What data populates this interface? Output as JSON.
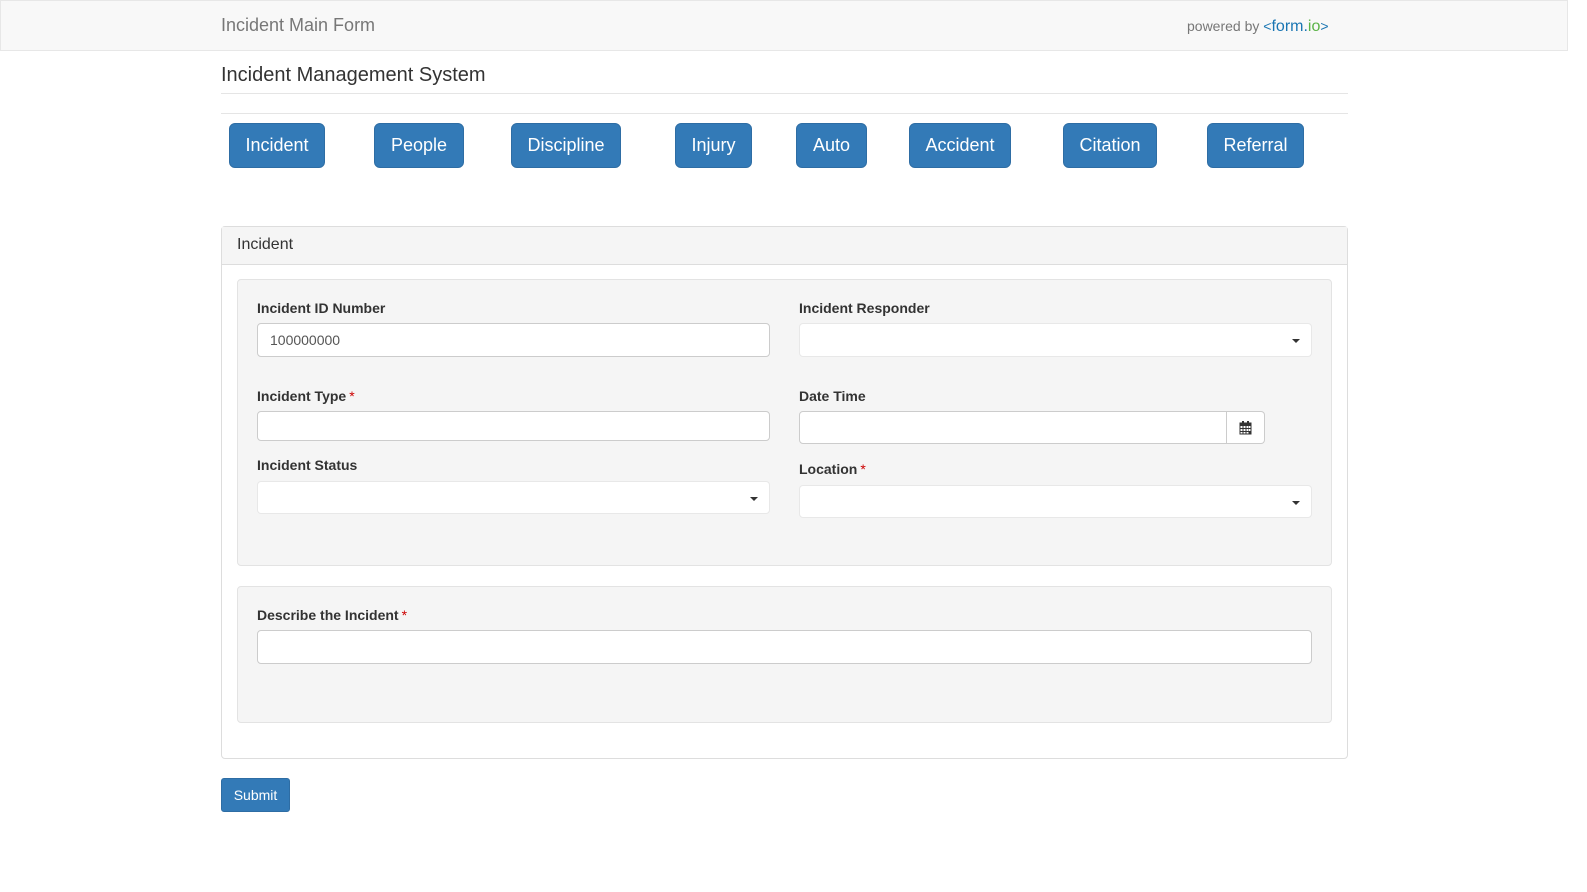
{
  "navbar": {
    "brand": "Incident Main Form",
    "powered_by": "powered by",
    "logo_lt": "<",
    "logo_form": "form",
    "logo_dot": ".",
    "logo_io": "io",
    "logo_gt": ">"
  },
  "header": {
    "title": "Incident Management System"
  },
  "tabs": [
    {
      "label": "Incident"
    },
    {
      "label": "People"
    },
    {
      "label": "Discipline"
    },
    {
      "label": "Injury"
    },
    {
      "label": "Auto"
    },
    {
      "label": "Accident"
    },
    {
      "label": "Citation"
    },
    {
      "label": "Referral"
    }
  ],
  "panel": {
    "title": "Incident",
    "fields": {
      "incident_id": {
        "label": "Incident ID Number",
        "value": "100000000"
      },
      "incident_responder": {
        "label": "Incident Responder",
        "value": ""
      },
      "incident_type": {
        "label": "Incident Type",
        "required_mark": "*",
        "value": ""
      },
      "date_time": {
        "label": "Date Time",
        "value": ""
      },
      "incident_status": {
        "label": "Incident Status",
        "value": ""
      },
      "location": {
        "label": "Location",
        "required_mark": "*",
        "value": ""
      },
      "describe": {
        "label": "Describe the Incident",
        "required_mark": "*",
        "value": ""
      }
    }
  },
  "submit": {
    "label": "Submit"
  },
  "colors": {
    "primary": "#337ab7",
    "required": "#cc0000",
    "logo_blue": "#1a76b3",
    "logo_green": "#5bb347"
  },
  "icons": {
    "calendar": "calendar-icon",
    "dropdown": "caret-down-icon"
  }
}
